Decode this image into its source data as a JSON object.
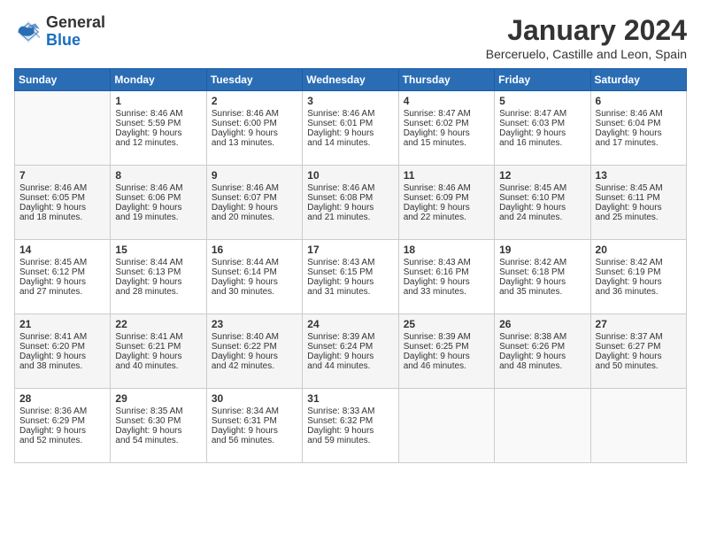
{
  "header": {
    "logo": {
      "general": "General",
      "blue": "Blue"
    },
    "title": "January 2024",
    "location": "Berceruelo, Castille and Leon, Spain"
  },
  "calendar": {
    "days_of_week": [
      "Sunday",
      "Monday",
      "Tuesday",
      "Wednesday",
      "Thursday",
      "Friday",
      "Saturday"
    ],
    "weeks": [
      [
        {
          "day": "",
          "content": ""
        },
        {
          "day": "1",
          "content": "Sunrise: 8:46 AM\nSunset: 5:59 PM\nDaylight: 9 hours\nand 12 minutes."
        },
        {
          "day": "2",
          "content": "Sunrise: 8:46 AM\nSunset: 6:00 PM\nDaylight: 9 hours\nand 13 minutes."
        },
        {
          "day": "3",
          "content": "Sunrise: 8:46 AM\nSunset: 6:01 PM\nDaylight: 9 hours\nand 14 minutes."
        },
        {
          "day": "4",
          "content": "Sunrise: 8:47 AM\nSunset: 6:02 PM\nDaylight: 9 hours\nand 15 minutes."
        },
        {
          "day": "5",
          "content": "Sunrise: 8:47 AM\nSunset: 6:03 PM\nDaylight: 9 hours\nand 16 minutes."
        },
        {
          "day": "6",
          "content": "Sunrise: 8:46 AM\nSunset: 6:04 PM\nDaylight: 9 hours\nand 17 minutes."
        }
      ],
      [
        {
          "day": "7",
          "content": "Sunrise: 8:46 AM\nSunset: 6:05 PM\nDaylight: 9 hours\nand 18 minutes."
        },
        {
          "day": "8",
          "content": "Sunrise: 8:46 AM\nSunset: 6:06 PM\nDaylight: 9 hours\nand 19 minutes."
        },
        {
          "day": "9",
          "content": "Sunrise: 8:46 AM\nSunset: 6:07 PM\nDaylight: 9 hours\nand 20 minutes."
        },
        {
          "day": "10",
          "content": "Sunrise: 8:46 AM\nSunset: 6:08 PM\nDaylight: 9 hours\nand 21 minutes."
        },
        {
          "day": "11",
          "content": "Sunrise: 8:46 AM\nSunset: 6:09 PM\nDaylight: 9 hours\nand 22 minutes."
        },
        {
          "day": "12",
          "content": "Sunrise: 8:45 AM\nSunset: 6:10 PM\nDaylight: 9 hours\nand 24 minutes."
        },
        {
          "day": "13",
          "content": "Sunrise: 8:45 AM\nSunset: 6:11 PM\nDaylight: 9 hours\nand 25 minutes."
        }
      ],
      [
        {
          "day": "14",
          "content": "Sunrise: 8:45 AM\nSunset: 6:12 PM\nDaylight: 9 hours\nand 27 minutes."
        },
        {
          "day": "15",
          "content": "Sunrise: 8:44 AM\nSunset: 6:13 PM\nDaylight: 9 hours\nand 28 minutes."
        },
        {
          "day": "16",
          "content": "Sunrise: 8:44 AM\nSunset: 6:14 PM\nDaylight: 9 hours\nand 30 minutes."
        },
        {
          "day": "17",
          "content": "Sunrise: 8:43 AM\nSunset: 6:15 PM\nDaylight: 9 hours\nand 31 minutes."
        },
        {
          "day": "18",
          "content": "Sunrise: 8:43 AM\nSunset: 6:16 PM\nDaylight: 9 hours\nand 33 minutes."
        },
        {
          "day": "19",
          "content": "Sunrise: 8:42 AM\nSunset: 6:18 PM\nDaylight: 9 hours\nand 35 minutes."
        },
        {
          "day": "20",
          "content": "Sunrise: 8:42 AM\nSunset: 6:19 PM\nDaylight: 9 hours\nand 36 minutes."
        }
      ],
      [
        {
          "day": "21",
          "content": "Sunrise: 8:41 AM\nSunset: 6:20 PM\nDaylight: 9 hours\nand 38 minutes."
        },
        {
          "day": "22",
          "content": "Sunrise: 8:41 AM\nSunset: 6:21 PM\nDaylight: 9 hours\nand 40 minutes."
        },
        {
          "day": "23",
          "content": "Sunrise: 8:40 AM\nSunset: 6:22 PM\nDaylight: 9 hours\nand 42 minutes."
        },
        {
          "day": "24",
          "content": "Sunrise: 8:39 AM\nSunset: 6:24 PM\nDaylight: 9 hours\nand 44 minutes."
        },
        {
          "day": "25",
          "content": "Sunrise: 8:39 AM\nSunset: 6:25 PM\nDaylight: 9 hours\nand 46 minutes."
        },
        {
          "day": "26",
          "content": "Sunrise: 8:38 AM\nSunset: 6:26 PM\nDaylight: 9 hours\nand 48 minutes."
        },
        {
          "day": "27",
          "content": "Sunrise: 8:37 AM\nSunset: 6:27 PM\nDaylight: 9 hours\nand 50 minutes."
        }
      ],
      [
        {
          "day": "28",
          "content": "Sunrise: 8:36 AM\nSunset: 6:29 PM\nDaylight: 9 hours\nand 52 minutes."
        },
        {
          "day": "29",
          "content": "Sunrise: 8:35 AM\nSunset: 6:30 PM\nDaylight: 9 hours\nand 54 minutes."
        },
        {
          "day": "30",
          "content": "Sunrise: 8:34 AM\nSunset: 6:31 PM\nDaylight: 9 hours\nand 56 minutes."
        },
        {
          "day": "31",
          "content": "Sunrise: 8:33 AM\nSunset: 6:32 PM\nDaylight: 9 hours\nand 59 minutes."
        },
        {
          "day": "",
          "content": ""
        },
        {
          "day": "",
          "content": ""
        },
        {
          "day": "",
          "content": ""
        }
      ]
    ]
  }
}
